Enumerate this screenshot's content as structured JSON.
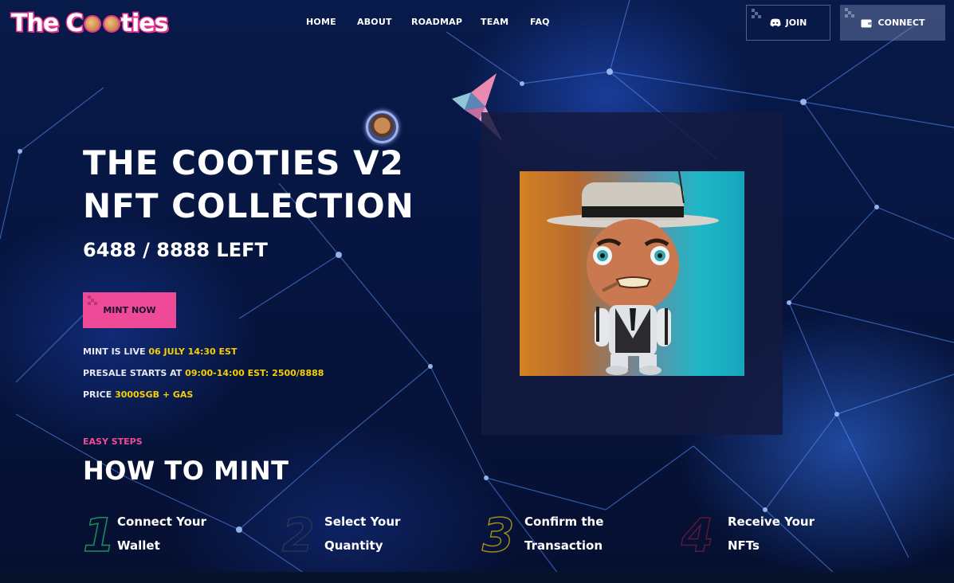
{
  "brand": {
    "logo_text_1": "The C",
    "logo_text_2": "ties"
  },
  "nav": {
    "home": "HOME",
    "about": "ABOUT",
    "roadmap": "ROADMAP",
    "team": "TEAM",
    "faq": "FAQ"
  },
  "header_buttons": {
    "join": "JOIN",
    "connect": "CONNECT"
  },
  "hero": {
    "title_line1": "THE COOTIES V2",
    "title_line2": "NFT COLLECTION",
    "remaining": "6488 / 8888 LEFT",
    "mint_button": "MINT NOW",
    "mint_live_label": "MINT IS LIVE",
    "mint_live_value": "06 JULY 14:30 EST",
    "presale_label": "PRESALE STARTS AT",
    "presale_value": "09:00-14:00 EST: 2500/8888",
    "price_label": "PRICE",
    "price_value": "3000SGB + GAS"
  },
  "how_to_mint": {
    "kicker": "EASY STEPS",
    "title": "HOW TO MINT",
    "steps": [
      {
        "number": "1",
        "line1": "Connect Your",
        "line2": "Wallet",
        "color": "#1f8f5a"
      },
      {
        "number": "2",
        "line1": "Select Your",
        "line2": "Quantity",
        "color": "#2a3550"
      },
      {
        "number": "3",
        "line1": "Confirm the",
        "line2": "Transaction",
        "color": "#a08a20"
      },
      {
        "number": "4",
        "line1": "Receive Your",
        "line2": "NFTs",
        "color": "#5a1a3a"
      }
    ]
  },
  "colors": {
    "accent_pink": "#ef4a98",
    "highlight_yellow": "#f6d000",
    "background": "#06153f"
  },
  "icons": {
    "join": "discord-icon",
    "connect": "wallet-icon"
  }
}
